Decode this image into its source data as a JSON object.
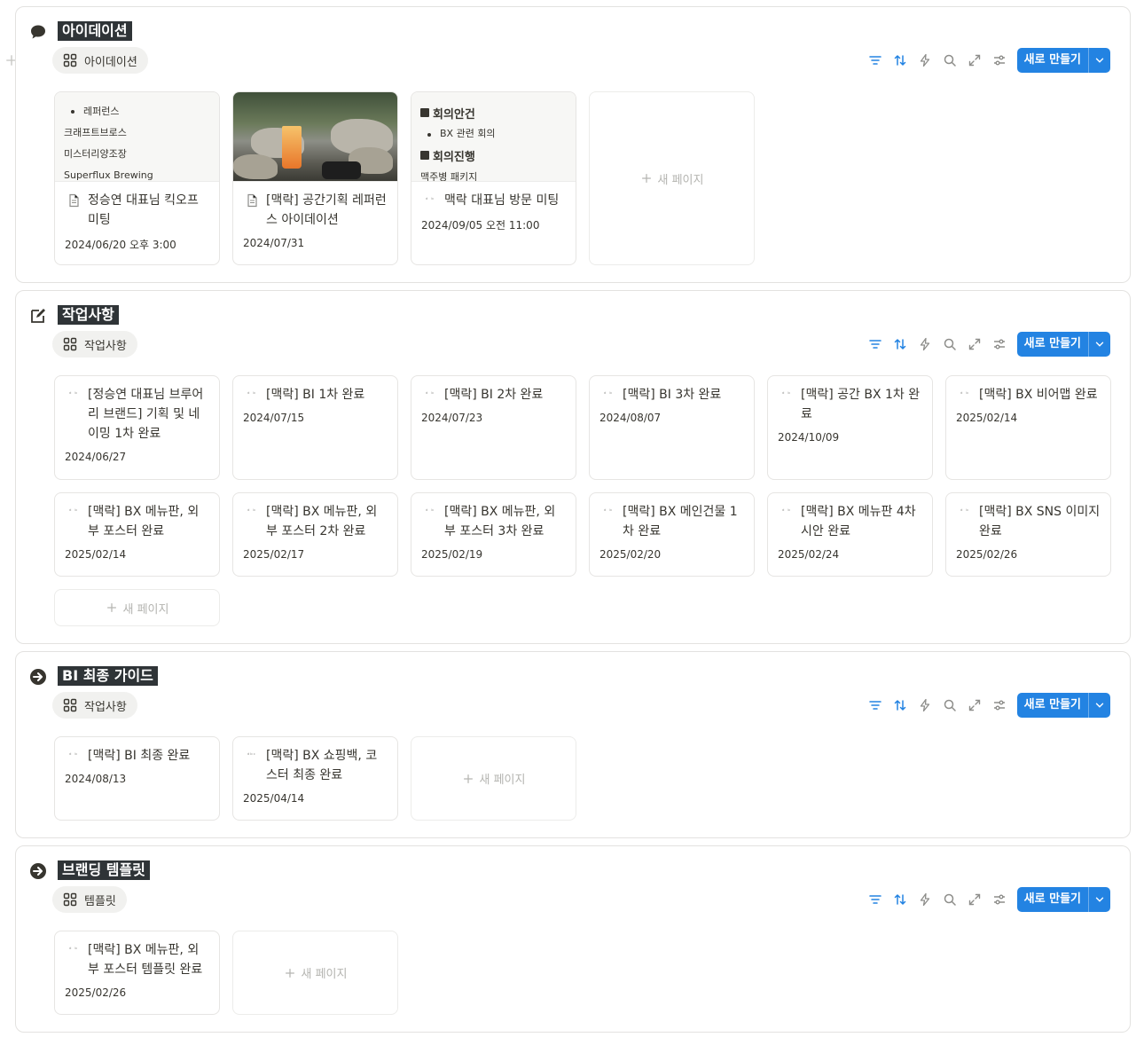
{
  "colors": {
    "accent": "#2383e2",
    "title_bg": "#2f3437"
  },
  "toolbar": {
    "icons": [
      "filter-icon",
      "sort-icon",
      "lightning-icon",
      "search-icon",
      "expand-icon",
      "settings-icon"
    ],
    "new_label": "새로 만들기"
  },
  "new_page_label": "새 페이지",
  "sections": [
    {
      "title": "아이데이션",
      "icon": "speech-bubble-icon",
      "view_tab": "아이데이션",
      "cards": [
        {
          "preview": {
            "bullet": "레퍼런스",
            "lines": [
              "크래프트브로스",
              "미스터리양조장",
              "Superflux Brewing"
            ]
          },
          "title": "정승연 대표님 킥오프 미팅",
          "date": "2024/06/20 오후 3:00"
        },
        {
          "title": "[맥락] 공간기획 레퍼런스 아이데이션",
          "date": "2024/07/31"
        },
        {
          "preview": {
            "heading1": "회의안건",
            "bullet": "BX 관련 회의",
            "heading2": "회의진행",
            "line": "맥주병 패키지"
          },
          "title": "맥락 대표님 방문 미팅",
          "date": "2024/09/05 오전 11:00"
        }
      ]
    },
    {
      "title": "작업사항",
      "icon": "edit-icon",
      "view_tab": "작업사항",
      "cards": [
        {
          "title": "[정승연 대표님 브루어리 브랜드] 기획 및 네이밍 1차 완료",
          "date": "2024/06/27"
        },
        {
          "title": "[맥락] BI 1차 완료",
          "date": "2024/07/15"
        },
        {
          "title": "[맥락] BI 2차 완료",
          "date": "2024/07/23"
        },
        {
          "title": "[맥락] BI 3차 완료",
          "date": "2024/08/07"
        },
        {
          "title": "[맥락] 공간 BX 1차 완료",
          "date": "2024/10/09"
        },
        {
          "title": "[맥락] BX 비어맵 완료",
          "date": "2025/02/14"
        },
        {
          "title": "[맥락] BX 메뉴판, 외부 포스터 완료",
          "date": "2025/02/14"
        },
        {
          "title": "[맥락] BX 메뉴판, 외부 포스터 2차 완료",
          "date": "2025/02/17"
        },
        {
          "title": "[맥락] BX 메뉴판, 외부 포스터 3차 완료",
          "date": "2025/02/19"
        },
        {
          "title": "[맥락] BX 메인건물 1차 완료",
          "date": "2025/02/20"
        },
        {
          "title": "[맥락] BX 메뉴판 4차 시안 완료",
          "date": "2025/02/24"
        },
        {
          "title": "[맥락] BX SNS 이미지 완료",
          "date": "2025/02/26"
        }
      ]
    },
    {
      "title": "BI 최종 가이드",
      "icon": "arrow-circle-icon",
      "view_tab": "작업사항",
      "cards": [
        {
          "title": "[맥락] BI 최종 완료",
          "date": "2024/08/13"
        },
        {
          "title": "[맥락] BX 쇼핑백, 코스터 최종 완료",
          "date": "2025/04/14"
        }
      ]
    },
    {
      "title": "브랜딩 템플릿",
      "icon": "arrow-circle-icon",
      "view_tab": "템플릿",
      "cards": [
        {
          "title": "[맥락] BX 메뉴판, 외부 포스터 템플릿 완료",
          "date": "2025/02/26"
        }
      ]
    }
  ]
}
